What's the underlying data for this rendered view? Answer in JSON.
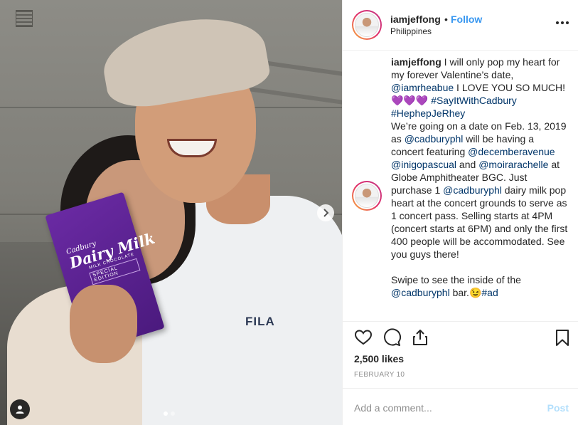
{
  "post": {
    "username": "iamjeffong",
    "bullet": "•",
    "follow_label": "Follow",
    "location": "Philippines",
    "more_icon": "more-options-icon"
  },
  "photo": {
    "shirt_logo": "FILA",
    "product": {
      "brand_small": "Cadbury",
      "brand_large": "Dairy Milk",
      "sub_line": "MILK CHOCOLATE",
      "edition": "SPECIAL EDITION"
    },
    "carousel": {
      "total_slides": 2,
      "active_slide": 1
    },
    "icons": [
      "chevron-right-icon",
      "user-tag-icon"
    ]
  },
  "caption": {
    "author": "iamjeffong",
    "segments": [
      {
        "type": "text",
        "text": " I will only pop my heart for my forever Valentine’s date, "
      },
      {
        "type": "mention",
        "text": "@iamrheabue"
      },
      {
        "type": "text",
        "text": " I LOVE YOU SO MUCH!"
      },
      {
        "type": "emoji",
        "text": "💜💜💜"
      },
      {
        "type": "text",
        "text": " "
      },
      {
        "type": "tag",
        "text": "#SayItWithCadbury"
      },
      {
        "type": "text",
        "text": "\n"
      },
      {
        "type": "tag",
        "text": "#HephepJeRhey"
      },
      {
        "type": "text",
        "text": "\nWe’re going on a date on Feb. 13, 2019 as "
      },
      {
        "type": "mention",
        "text": "@cadburyphl"
      },
      {
        "type": "text",
        "text": " will be having a concert featuring "
      },
      {
        "type": "mention",
        "text": "@decemberavenue"
      },
      {
        "type": "text",
        "text": " "
      },
      {
        "type": "mention",
        "text": "@inigopascual"
      },
      {
        "type": "text",
        "text": " and "
      },
      {
        "type": "mention",
        "text": "@moirarachelle"
      },
      {
        "type": "text",
        "text": " at Globe Amphitheater BGC. Just purchase 1 "
      },
      {
        "type": "mention",
        "text": "@cadburyphl"
      },
      {
        "type": "text",
        "text": " dairy milk pop heart at the concert grounds to serve as 1 concert pass. Selling starts at 4PM (concert starts at 6PM) and only the first 400 people will be accommodated. See you guys there!\n\nSwipe to see the inside of the "
      },
      {
        "type": "mention",
        "text": "@cadburyphl"
      },
      {
        "type": "text",
        "text": " bar."
      },
      {
        "type": "emoji",
        "text": "😉"
      },
      {
        "type": "tag",
        "text": "#ad"
      }
    ]
  },
  "actions": {
    "icons": [
      "heart-icon",
      "comment-icon",
      "share-icon",
      "bookmark-icon"
    ],
    "likes_text": "2,500 likes",
    "date_text": "FEBRUARY 10"
  },
  "comment": {
    "placeholder": "Add a comment...",
    "post_label": "Post"
  },
  "colors": {
    "link": "#003569",
    "follow": "#3897f0",
    "post_disabled": "#b2dffc",
    "muted": "#8e8e8e",
    "text": "#262626"
  }
}
